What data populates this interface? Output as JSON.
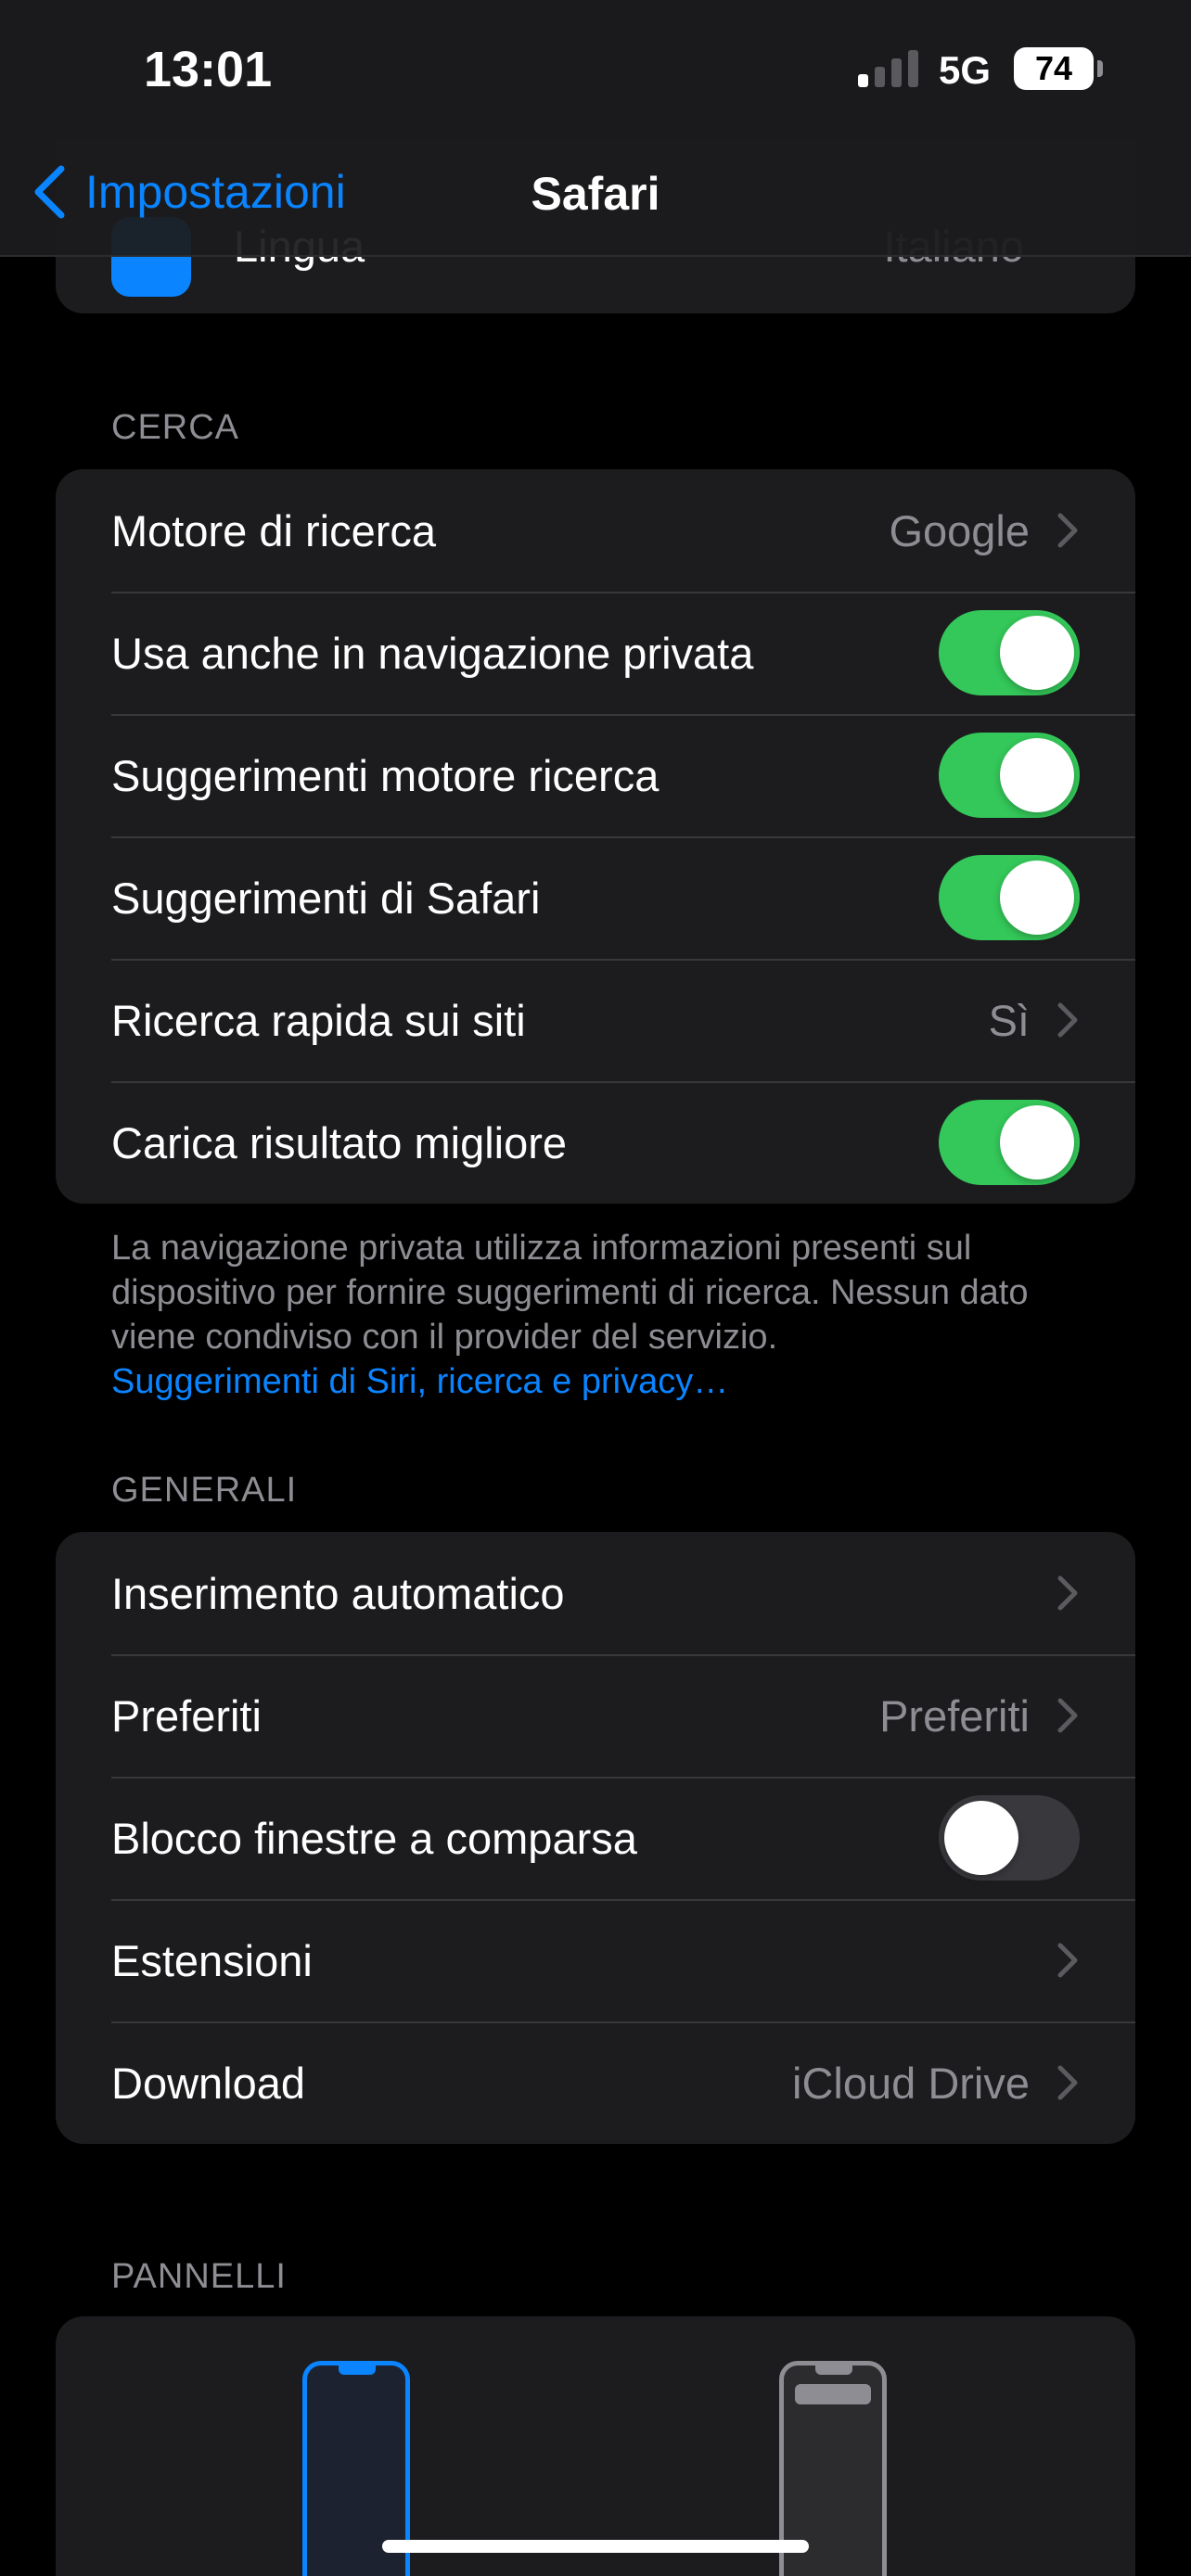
{
  "status_bar": {
    "time": "13:01",
    "network": "5G",
    "battery": "74"
  },
  "nav": {
    "back_label": "Impostazioni",
    "title": "Safari"
  },
  "previous_row": {
    "label": "Lingua",
    "value": "Italiano",
    "icon": "globe-icon"
  },
  "search_section": {
    "header": "CERCA",
    "rows": [
      {
        "label": "Motore di ricerca",
        "value": "Google",
        "type": "disclosure"
      },
      {
        "label": "Usa anche in navigazione privata",
        "type": "toggle",
        "on": true
      },
      {
        "label": "Suggerimenti motore ricerca",
        "type": "toggle",
        "on": true
      },
      {
        "label": "Suggerimenti di Safari",
        "type": "toggle",
        "on": true
      },
      {
        "label": "Ricerca rapida sui siti",
        "value": "Sì",
        "type": "disclosure"
      },
      {
        "label": "Carica risultato migliore",
        "type": "toggle",
        "on": true
      }
    ],
    "footer_text": "La navigazione privata utilizza informazioni presenti sul dispositivo per fornire suggerimenti di ricerca. Nessun dato viene condiviso con il provider del servizio.",
    "footer_link": "Suggerimenti di Siri, ricerca e privacy…"
  },
  "general_section": {
    "header": "GENERALI",
    "rows": [
      {
        "label": "Inserimento automatico",
        "value": "",
        "type": "disclosure"
      },
      {
        "label": "Preferiti",
        "value": "Preferiti",
        "type": "disclosure"
      },
      {
        "label": "Blocco finestre a comparsa",
        "type": "toggle",
        "on": false
      },
      {
        "label": "Estensioni",
        "value": "",
        "type": "disclosure"
      },
      {
        "label": "Download",
        "value": "iCloud Drive",
        "type": "disclosure"
      }
    ]
  },
  "panels_section": {
    "header": "PANNELLI"
  },
  "colors": {
    "accent": "#0a84ff",
    "toggle_on": "#34c759",
    "toggle_off": "#39393d",
    "group_bg": "#1c1c1e",
    "secondary_text": "#8d8d93"
  }
}
